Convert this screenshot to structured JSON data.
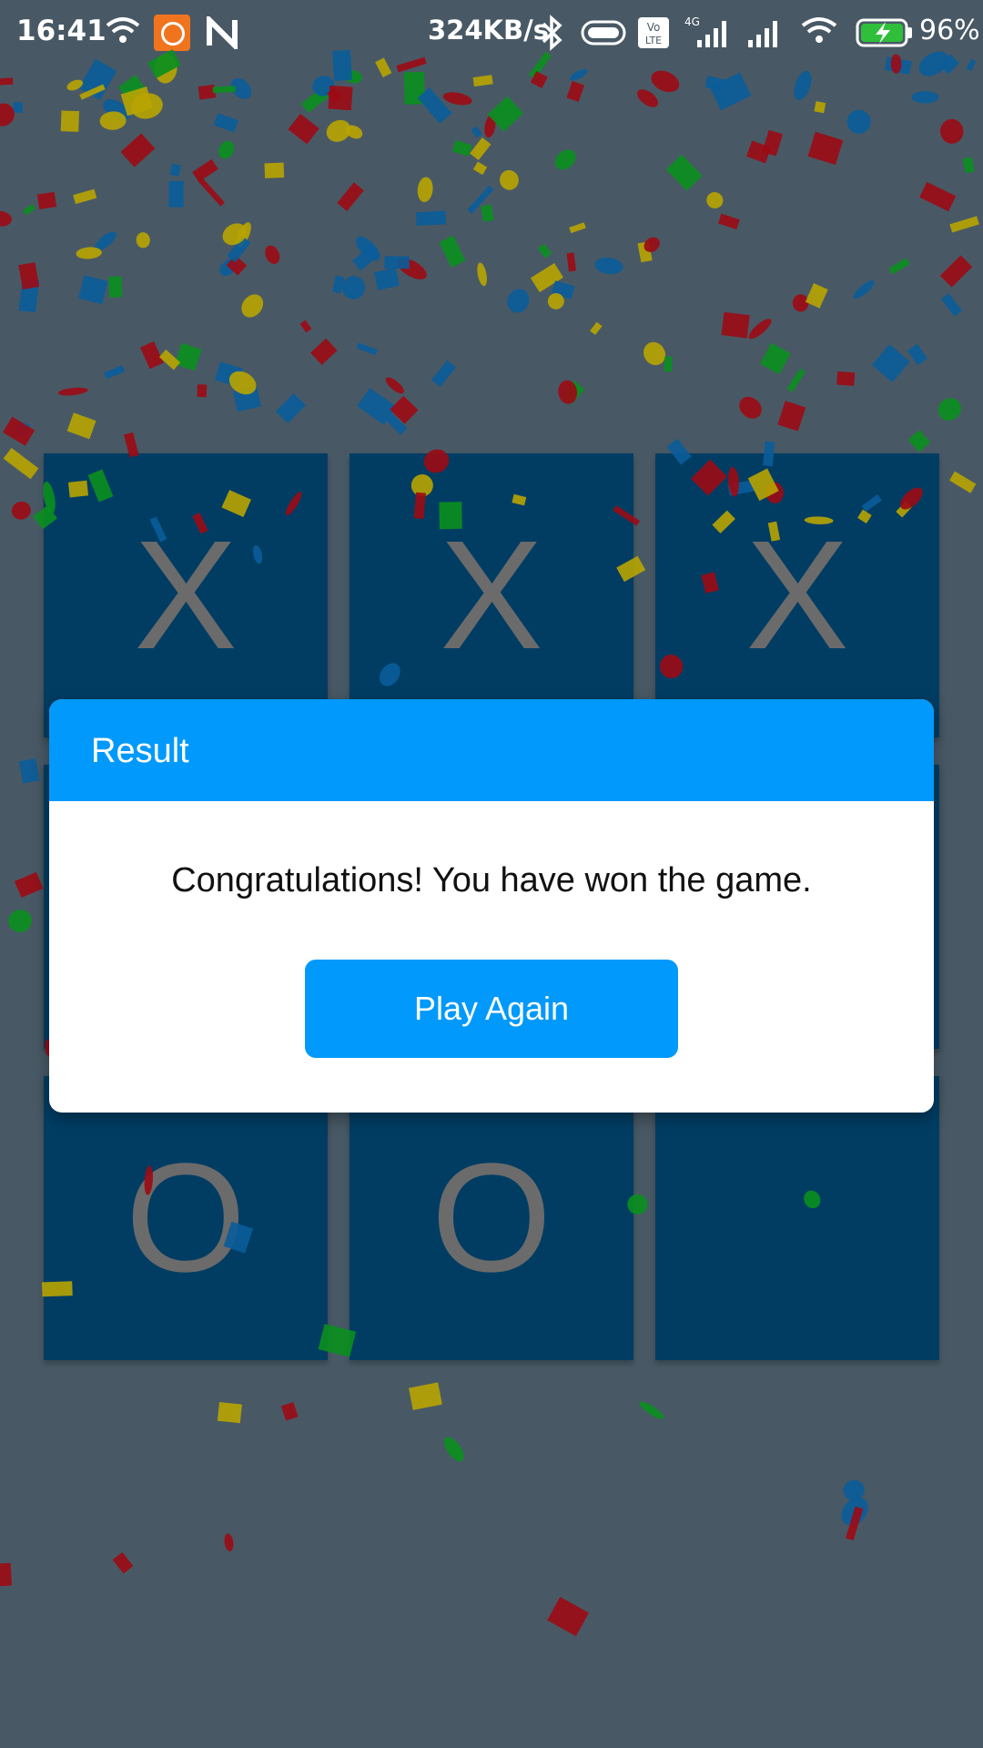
{
  "status_bar": {
    "time": "16:41",
    "network_speed": "324KB/s",
    "battery": "96%",
    "icons": [
      "wifi-icon",
      "mi-app-icon",
      "n-app-icon",
      "bluetooth-icon",
      "toggle-icon",
      "volte-icon",
      "signal-4g-icon",
      "signal-icon",
      "wifi-icon",
      "battery-charging-icon"
    ]
  },
  "board": {
    "cells": [
      "X",
      "X",
      "X",
      "",
      "",
      "",
      "O",
      "O",
      ""
    ]
  },
  "dialog": {
    "title": "Result",
    "message": "Congratulations! You have won the game.",
    "button_label": "Play Again"
  },
  "colors": {
    "background": "#485965",
    "cell": "#013d63",
    "mark": "#6b6b6b",
    "accent": "#0199fb",
    "confetti": [
      "#b8a400",
      "#0a5c9a",
      "#9c0a14",
      "#0a8f1e"
    ]
  }
}
